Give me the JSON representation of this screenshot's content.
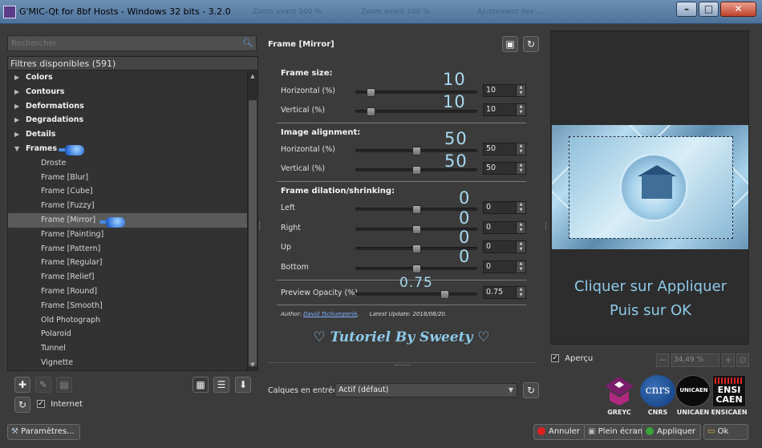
{
  "window": {
    "title": "G'MIC-Qt for 8bf Hosts - Windows 32 bits - 3.2.0",
    "ghost_text_1": "Zoom avant 100 %",
    "ghost_text_2": "Zoom avant 100 %",
    "ghost_text_3": "Ajustement des ..."
  },
  "sidebar": {
    "search_placeholder": "Rechercher",
    "header": "Filtres disponibles (591)",
    "tree": [
      {
        "label": "Colors",
        "type": "category",
        "expanded": false
      },
      {
        "label": "Contours",
        "type": "category",
        "expanded": false
      },
      {
        "label": "Deformations",
        "type": "category",
        "expanded": false
      },
      {
        "label": "Degradations",
        "type": "category",
        "expanded": false
      },
      {
        "label": "Details",
        "type": "category",
        "expanded": false
      },
      {
        "label": "Frames",
        "type": "category",
        "expanded": true
      },
      {
        "label": "Droste",
        "type": "item"
      },
      {
        "label": "Frame [Blur]",
        "type": "item"
      },
      {
        "label": "Frame [Cube]",
        "type": "item"
      },
      {
        "label": "Frame [Fuzzy]",
        "type": "item"
      },
      {
        "label": "Frame [Mirror]",
        "type": "item",
        "selected": true
      },
      {
        "label": "Frame [Painting]",
        "type": "item"
      },
      {
        "label": "Frame [Pattern]",
        "type": "item"
      },
      {
        "label": "Frame [Regular]",
        "type": "item"
      },
      {
        "label": "Frame [Relief]",
        "type": "item"
      },
      {
        "label": "Frame [Round]",
        "type": "item"
      },
      {
        "label": "Frame [Smooth]",
        "type": "item"
      },
      {
        "label": "Old Photograph",
        "type": "item"
      },
      {
        "label": "Polaroid",
        "type": "item"
      },
      {
        "label": "Tunnel",
        "type": "item"
      },
      {
        "label": "Vignette",
        "type": "item"
      }
    ],
    "internet_label": "Internet",
    "settings_button": "Paramètres..."
  },
  "filter": {
    "title": "Frame [Mirror]",
    "sections": {
      "size": "Frame size:",
      "alignment": "Image alignment:",
      "dilation": "Frame dilation/shrinking:"
    },
    "params": {
      "size_h": {
        "label": "Horizontal (%)",
        "value": "10",
        "fraction": 0.1,
        "note": "10"
      },
      "size_v": {
        "label": "Vertical (%)",
        "value": "10",
        "fraction": 0.1,
        "note": "10"
      },
      "align_h": {
        "label": "Horizontal (%)",
        "value": "50",
        "fraction": 0.5,
        "note": "50"
      },
      "align_v": {
        "label": "Vertical (%)",
        "value": "50",
        "fraction": 0.5,
        "note": "50"
      },
      "left": {
        "label": "Left",
        "value": "0",
        "fraction": 0.5,
        "note": "0"
      },
      "right": {
        "label": "Right",
        "value": "0",
        "fraction": 0.5,
        "note": "0"
      },
      "up": {
        "label": "Up",
        "value": "0",
        "fraction": 0.5,
        "note": "0"
      },
      "bottom": {
        "label": "Bottom",
        "value": "0",
        "fraction": 0.5,
        "note": "0"
      },
      "opacity": {
        "label": "Preview Opacity (%)",
        "value": "0.75",
        "fraction": 0.75,
        "note": "0.75"
      }
    },
    "author_label": "Author:",
    "author_name": "David Tschumperlé",
    "update_label": "Latest Update:",
    "update_date": "2018/08/20",
    "tutorial_note": "♡ Tutoriel By Sweety ♡",
    "input_layers_label": "Calques en entrée",
    "input_layers_value": "Actif (défaut)"
  },
  "preview": {
    "instruction_1": "Cliquer sur Appliquer",
    "instruction_2": "Puis sur OK",
    "apercu_label": "Aperçu",
    "zoom_value": "34,49 %"
  },
  "logos": [
    "GREYC",
    "CNRS",
    "UNICAEN",
    "ENSICAEN"
  ],
  "logo_text": {
    "cnrs": "cnrs",
    "unicaen": "UNICAEN",
    "ensicaen_1": "ENSI",
    "ensicaen_2": "CAEN"
  },
  "actions": {
    "cancel": "Annuler",
    "fullscreen": "Plein écran",
    "apply": "Appliquer",
    "ok": "Ok"
  },
  "colors": {
    "accent": "#a8d8f0",
    "cancel_dot": "#e02020",
    "apply_dot": "#3aa33a"
  }
}
